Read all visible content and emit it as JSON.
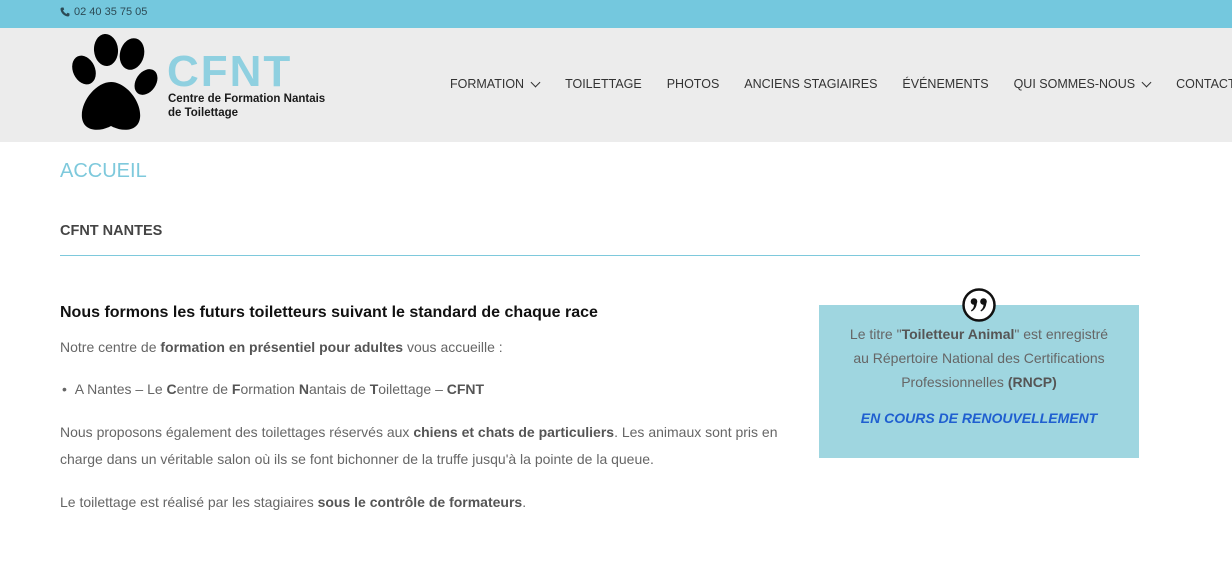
{
  "topbar": {
    "phone": "02 40 35 75 05"
  },
  "header": {
    "logo_title": "CFNT",
    "logo_subtitle_line1": "Centre de Formation Nantais",
    "logo_subtitle_line2": "de Toilettage",
    "nav": [
      {
        "label": "FORMATION",
        "has_dropdown": true
      },
      {
        "label": "TOILETTAGE",
        "has_dropdown": false
      },
      {
        "label": "PHOTOS",
        "has_dropdown": false
      },
      {
        "label": "ANCIENS STAGIAIRES",
        "has_dropdown": false
      },
      {
        "label": "ÉVÉNEMENTS",
        "has_dropdown": false
      },
      {
        "label": "QUI SOMMES-NOUS",
        "has_dropdown": true
      },
      {
        "label": "CONTACT",
        "has_dropdown": false
      }
    ]
  },
  "main": {
    "page_title": "ACCUEIL",
    "section_title": "CFNT NANTES",
    "headline": "Nous formons les futurs toiletteurs suivant le standard de chaque race",
    "intro_prefix": "Notre centre de ",
    "intro_bold": "formation en présentiel pour adultes",
    "intro_suffix": " vous accueille :",
    "bullet_prefix": "A Nantes – Le ",
    "bullet_c": "C",
    "bullet_entre": "entre de ",
    "bullet_f": "F",
    "bullet_ormation": "ormation ",
    "bullet_n": "N",
    "bullet_antais": "antais de ",
    "bullet_t": "T",
    "bullet_oilettage": "oilettage – ",
    "bullet_cfnt": "CFNT",
    "p2_prefix": "Nous proposons également des toilettages réservés aux ",
    "p2_bold": "chiens et chats de particuliers",
    "p2_line1_suffix": ". Les animaux sont pris en",
    "p2_line2": "charge dans un véritable salon où ils se font bichonner de la truffe jusqu'à la pointe de la queue.",
    "p3_prefix": "Le toilettage est réalisé par les stagiaires ",
    "p3_bold": "sous le contrôle de formateurs",
    "p3_suffix": "."
  },
  "quote": {
    "line1_prefix": "Le titre \"",
    "line1_bold": "Toiletteur Animal",
    "line1_suffix": "\" est enregistré",
    "line2": "au Répertoire National des Certifications",
    "line3_prefix": "Professionnelles ",
    "line3_bold": "(RNCP)",
    "status": "EN COURS DE RENOUVELLEMENT"
  },
  "colors": {
    "topbar": "#74c8de",
    "accent": "#7ec9dc",
    "quote_bg": "#9fd6e0",
    "status_blue": "#1f5fd0"
  }
}
